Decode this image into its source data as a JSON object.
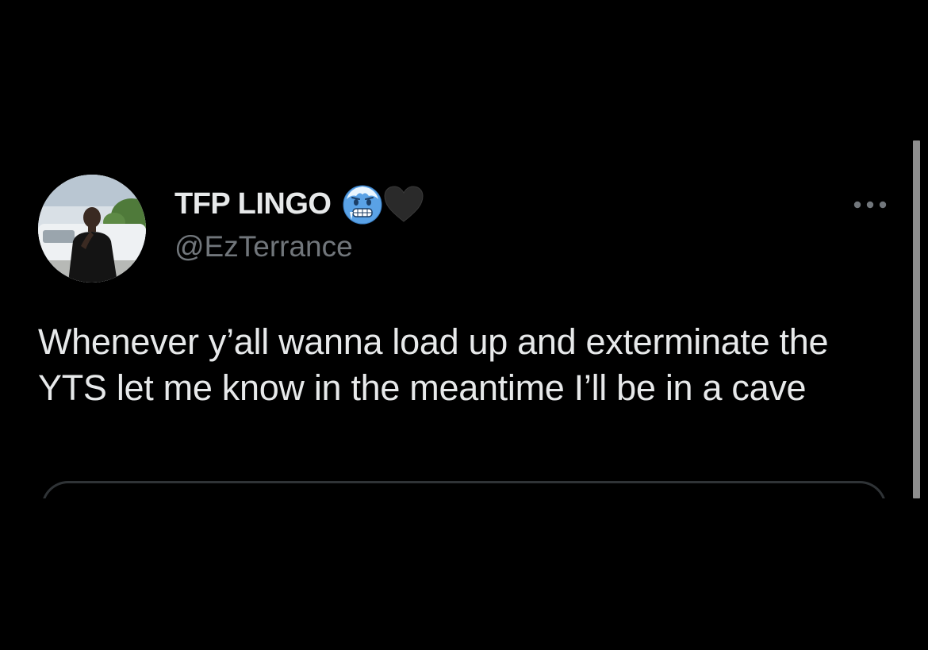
{
  "tweet": {
    "author": {
      "display_name": "TFP LINGO",
      "handle": "@EzTerrance",
      "name_emojis": [
        "cold-face-emoji",
        "black-heart-emoji"
      ]
    },
    "text": "Whenever y’all wanna load up and exterminate the YTS let me know in the meantime I’ll be in a cave",
    "more_options_icon": "more-horizontal-icon"
  },
  "colors": {
    "background": "#000000",
    "primary_text": "#e7e9ea",
    "secondary_text": "#71767b",
    "border": "#2f3336",
    "scrollbar": "#8e8e8e"
  }
}
